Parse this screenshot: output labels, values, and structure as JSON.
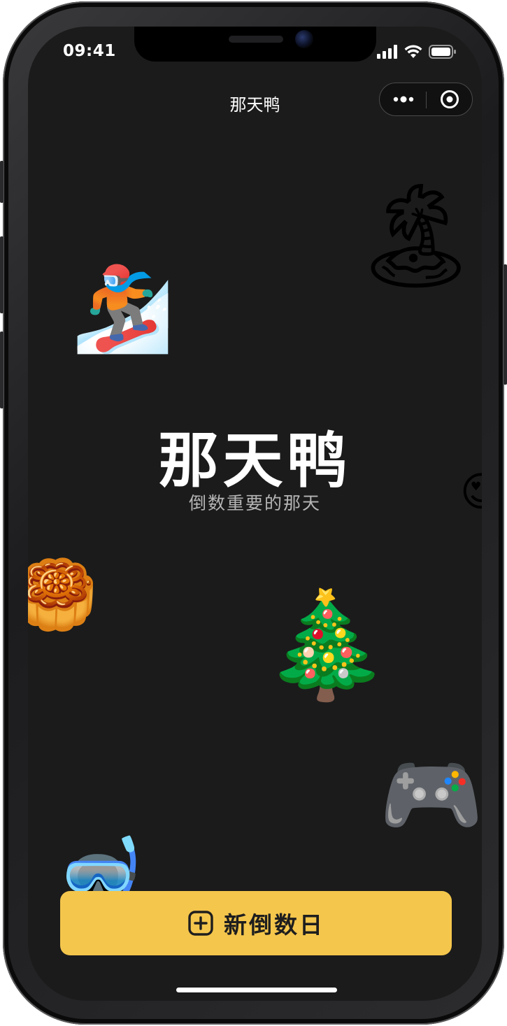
{
  "status_bar": {
    "time": "09:41",
    "icons": [
      "signal-icon",
      "wifi-icon",
      "battery-icon"
    ]
  },
  "nav": {
    "title": "那天鸭",
    "capsule_icons": [
      "more-dots-icon",
      "close-target-icon"
    ]
  },
  "hero": {
    "title": "那天鸭",
    "subtitle": "倒数重要的那天"
  },
  "emojis": [
    {
      "name": "beach-umbrella-emoji",
      "glyph": "🏝"
    },
    {
      "name": "snowboarder-emoji",
      "glyph": "🏂"
    },
    {
      "name": "heart-eyes-emoji",
      "glyph": "😍"
    },
    {
      "name": "mooncake-emoji",
      "glyph": "🥮"
    },
    {
      "name": "christmas-tree-emoji",
      "glyph": "🎄"
    },
    {
      "name": "game-controller-emoji",
      "glyph": "🎮"
    },
    {
      "name": "diving-mask-emoji",
      "glyph": "🤿"
    }
  ],
  "cta": {
    "label": "新倒数日",
    "icon": "plus-square-icon"
  },
  "colors": {
    "background": "#1b1b1b",
    "accent": "#f4c64c",
    "text_primary": "#ffffff",
    "text_secondary": "#b6b6b6"
  }
}
